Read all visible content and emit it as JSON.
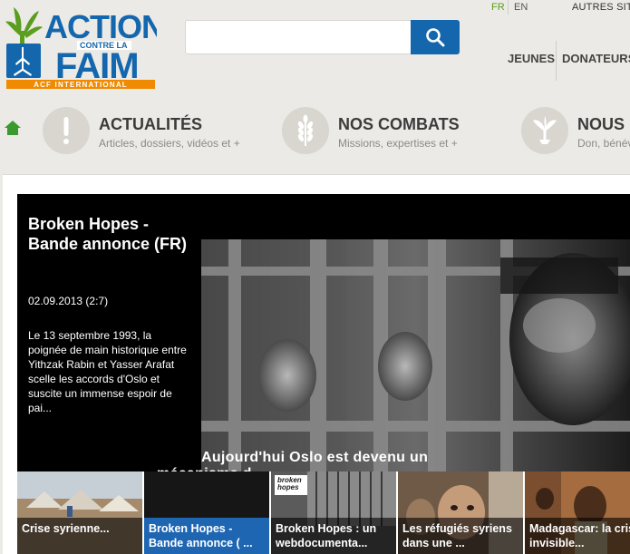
{
  "header": {
    "logo": {
      "line1": "ACTION",
      "line2": "CONTRE LA",
      "line3": "FAIM",
      "tagline": "ACF INTERNATIONAL"
    },
    "search": {
      "placeholder": "",
      "value": ""
    },
    "languages": {
      "fr": "FR",
      "en": "EN"
    },
    "other_sites": "AUTRES SITES",
    "nav": {
      "jeunes": "JEUNES",
      "donateurs": "DONATEURS"
    }
  },
  "menu": [
    {
      "title": "ACTUALITÉS",
      "subtitle": "Articles, dossiers, vidéos et +"
    },
    {
      "title": "NOS COMBATS",
      "subtitle": "Missions, expertises et +"
    },
    {
      "title": "NOUS",
      "subtitle": "Don, bénév"
    }
  ],
  "featured": {
    "title": "Broken Hopes - Bande annonce (FR)",
    "date": "02.09.2013 (2:7)",
    "description": "Le 13 septembre 1993, la poignée de main historique entre Yithzak Rabin et Yasser Arafat scelle les accords d'Oslo et suscite un immense espoir de pai...",
    "caption_line1": "Aujourd'hui Oslo est devenu un",
    "caption_line2": "mécanisme d"
  },
  "thumbnails": [
    {
      "label": "Crise syrienne...",
      "active": false
    },
    {
      "label": "Broken Hopes - Bande annonce ( ...",
      "active": true
    },
    {
      "label": "Broken Hopes : un webdocumenta...",
      "active": false,
      "overlay": "broken hopes"
    },
    {
      "label": "Les réfugiés syriens dans une ...",
      "active": false
    },
    {
      "label": "Madagascar: la crise invisible...",
      "active": false
    }
  ],
  "colors": {
    "brand_blue": "#1467ad",
    "brand_green": "#5b9d1f",
    "brand_orange": "#f08a00",
    "active_thumb": "#1f66b2"
  },
  "icons": {
    "search": "magnifier-icon",
    "home": "home-icon",
    "actualites": "exclamation-icon",
    "combats": "wheat-icon",
    "nous": "plant-icon"
  }
}
